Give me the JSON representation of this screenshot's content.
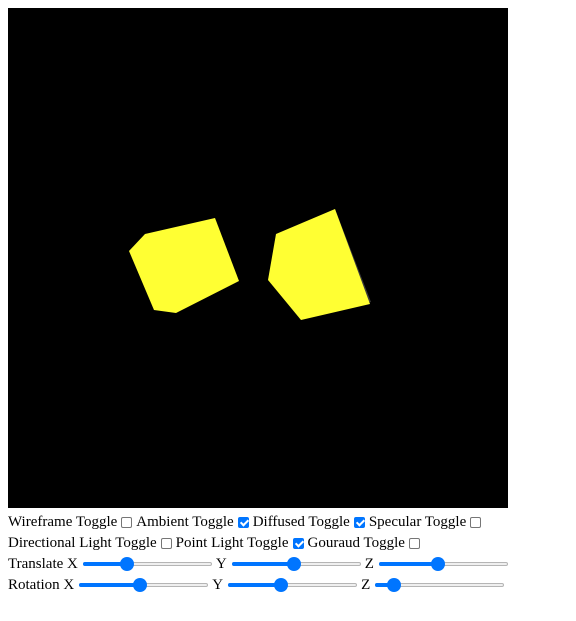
{
  "scene": {
    "background_color": "#000000",
    "cube_color": "#ffff33",
    "cube_shadow_color": "#3a3a3a"
  },
  "toggles": [
    {
      "label": "Wireframe Toggle",
      "checked": false
    },
    {
      "label": "Ambient Toggle",
      "checked": true
    },
    {
      "label": "Diffused Toggle",
      "checked": true
    },
    {
      "label": "Specular Toggle",
      "checked": false
    },
    {
      "label": "Directional Light Toggle",
      "checked": false
    },
    {
      "label": "Point Light Toggle",
      "checked": true
    },
    {
      "label": "Gouraud Toggle",
      "checked": false
    }
  ],
  "translate": {
    "label": "Translate X",
    "y_label": "Y",
    "z_label": "Z",
    "x_value": 0.32,
    "y_value": 0.48,
    "z_value": 0.45
  },
  "rotation": {
    "label": "Rotation X",
    "y_label": "Y",
    "z_label": "Z",
    "x_value": 0.47,
    "y_value": 0.4,
    "z_value": 0.1
  },
  "accent_color": "#0075ff"
}
